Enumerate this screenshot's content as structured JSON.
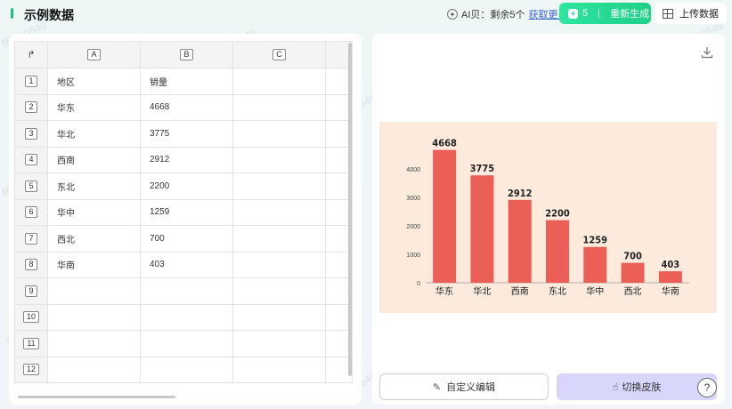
{
  "header": {
    "title": "示例数据",
    "ai_label": "AI贝：剩余5个",
    "ai_link": "获取更多",
    "regen_count": "5",
    "regen_label": "重新生成",
    "upload_label": "上传数据"
  },
  "sheet": {
    "columns": [
      "A",
      "B",
      "C"
    ],
    "rows": [
      {
        "num": "1",
        "a": "地区",
        "b": "销量"
      },
      {
        "num": "2",
        "a": "华东",
        "b": "4668"
      },
      {
        "num": "3",
        "a": "华北",
        "b": "3775"
      },
      {
        "num": "4",
        "a": "西南",
        "b": "2912"
      },
      {
        "num": "5",
        "a": "东北",
        "b": "2200"
      },
      {
        "num": "6",
        "a": "华中",
        "b": "1259"
      },
      {
        "num": "7",
        "a": "西北",
        "b": "700"
      },
      {
        "num": "8",
        "a": "华南",
        "b": "403"
      },
      {
        "num": "9",
        "a": "",
        "b": ""
      },
      {
        "num": "10",
        "a": "",
        "b": ""
      },
      {
        "num": "11",
        "a": "",
        "b": ""
      },
      {
        "num": "12",
        "a": "",
        "b": ""
      }
    ]
  },
  "chart_data": {
    "type": "bar",
    "categories": [
      "华东",
      "华北",
      "西南",
      "东北",
      "华中",
      "西北",
      "华南"
    ],
    "values": [
      4668,
      3775,
      2912,
      2200,
      1259,
      700,
      403
    ],
    "ylim": [
      0,
      4000
    ],
    "yticks": [
      0,
      1000,
      2000,
      3000,
      4000
    ],
    "bar_color": "#eb5f57",
    "background_color": "#fcebdd",
    "title": "",
    "xlabel": "",
    "ylabel": ""
  },
  "buttons": {
    "custom_edit": "自定义编辑",
    "switch_skin": "切换皮肤",
    "help": "?"
  },
  "watermark": "统力 0549",
  "icons": {
    "download": "download-icon",
    "help": "help-icon",
    "edit": "edit-icon",
    "grid": "grid-icon"
  },
  "colors": {
    "accent": "#21c07a",
    "link": "#3a64d8",
    "skin_button": "#d9d6fb"
  }
}
